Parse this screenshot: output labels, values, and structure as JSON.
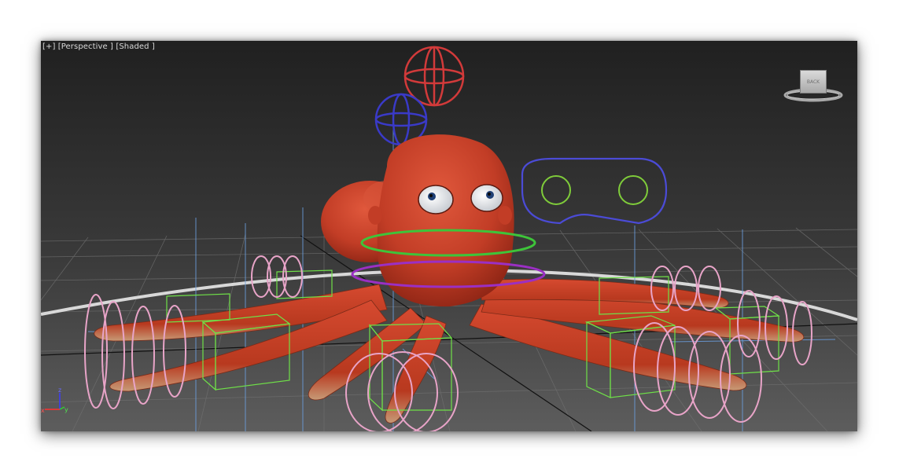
{
  "viewport": {
    "label": {
      "plus": "[+]",
      "view": "[Perspective ]",
      "shading": "[Shaded ]"
    },
    "background_top": "#212121",
    "background_bottom": "#5a5a5a"
  },
  "viewcube": {
    "face_label": "BACK"
  },
  "axis_tripod": {
    "x": "x",
    "y": "y",
    "z": "z"
  },
  "scene": {
    "character": "octopus",
    "body_color": "#c8412a",
    "rig_control_colors": {
      "box_controls": "#6fe048",
      "coil_controls": "#e8a4c8",
      "neck_ring_upper": "#3ec43a",
      "neck_ring_lower": "#9b2fc4",
      "head_sphere": "#d23a3a",
      "secondary_sphere": "#3a3ac8",
      "eye_control_frame": "#4b4bd6",
      "eye_control_circles": "#7fcc3a",
      "ground_ring": "#d8d8d8",
      "bone_lines": "#6b9fe0"
    }
  }
}
